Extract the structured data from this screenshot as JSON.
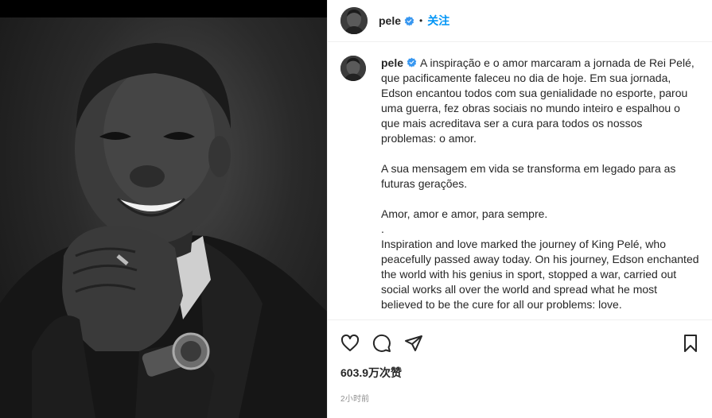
{
  "post": {
    "username": "pele",
    "follow_label": "关注",
    "separator": "•",
    "caption_user": "pele",
    "caption_text": "A inspiração e o amor marcaram a jornada de Rei Pelé, que pacificamente faleceu no dia de hoje. Em sua jornada, Edson encantou todos com sua genialidade no esporte, parou uma guerra, fez obras sociais no mundo inteiro e espalhou o que mais acreditava ser a cura para todos os nossos problemas: o amor.\n\nA sua mensagem em vida se transforma em legado para as futuras gerações.\n\nAmor, amor e amor, para sempre.\n.\nInspiration and love marked the journey of King Pelé, who peacefully passed away today. On his journey, Edson enchanted the world with his genius in sport, stopped a war, carried out social works all over the world and spread what he most believed to be the cure for all our problems: love.\n\nHis message today becomes a legacy for future generations.",
    "likes": "603.9万次赞",
    "time": "2小时前"
  },
  "icons": {
    "like": "heart-icon",
    "comment": "comment-icon",
    "share": "paper-plane-icon",
    "save": "bookmark-icon",
    "verified": "verified-badge-icon"
  },
  "colors": {
    "accent": "#0095f6",
    "text": "#262626",
    "muted": "#8e8e8e",
    "border": "#efefef"
  }
}
